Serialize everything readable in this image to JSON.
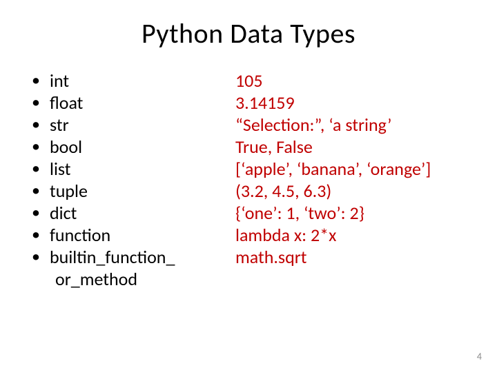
{
  "title": "Python Data Types",
  "types": {
    "items": [
      "int",
      "float",
      "str",
      "bool",
      "list",
      "tuple",
      "dict",
      "function",
      "builtin_function_"
    ],
    "continuation": "or_method"
  },
  "examples": {
    "items": [
      "105",
      "3.14159",
      "“Selection:”, ‘a string’",
      "True, False",
      "[‘apple’, ‘banana’, ‘orange’]",
      "(3.2, 4.5, 6.3)",
      "{‘one’: 1, ‘two’: 2}",
      "lambda x: 2*x",
      "math.sqrt"
    ]
  },
  "page_number": "4"
}
